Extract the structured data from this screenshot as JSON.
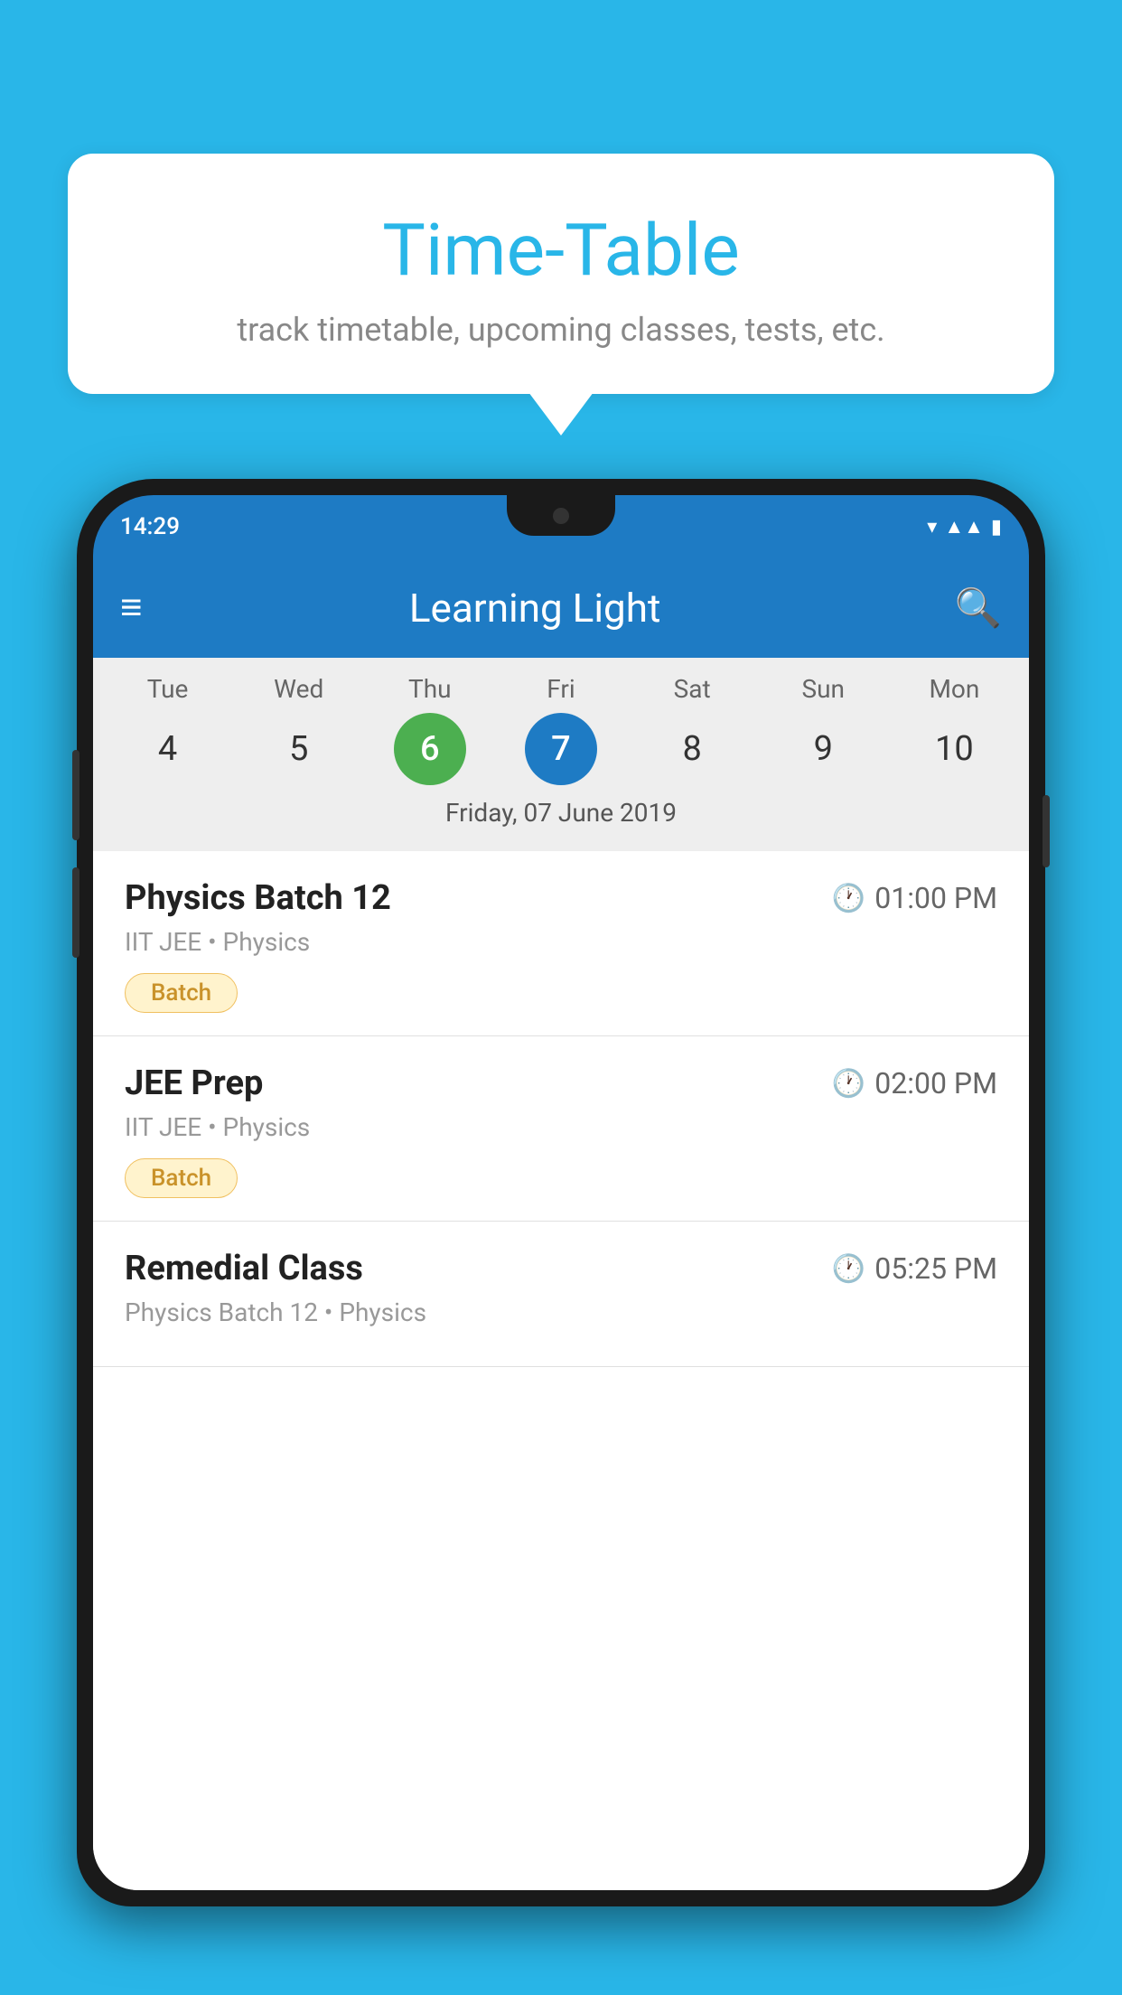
{
  "background_color": "#29b6e8",
  "tooltip": {
    "title": "Time-Table",
    "subtitle": "track timetable, upcoming classes, tests, etc."
  },
  "phone": {
    "status_time": "14:29",
    "app_name": "Learning Light",
    "calendar": {
      "days": [
        {
          "label": "Tue",
          "num": "4"
        },
        {
          "label": "Wed",
          "num": "5"
        },
        {
          "label": "Thu",
          "num": "6",
          "state": "today"
        },
        {
          "label": "Fri",
          "num": "7",
          "state": "selected"
        },
        {
          "label": "Sat",
          "num": "8"
        },
        {
          "label": "Sun",
          "num": "9"
        },
        {
          "label": "Mon",
          "num": "10"
        }
      ],
      "selected_date_label": "Friday, 07 June 2019"
    },
    "schedule": [
      {
        "title": "Physics Batch 12",
        "time": "01:00 PM",
        "subtitle": "IIT JEE • Physics",
        "badge": "Batch"
      },
      {
        "title": "JEE Prep",
        "time": "02:00 PM",
        "subtitle": "IIT JEE • Physics",
        "badge": "Batch"
      },
      {
        "title": "Remedial Class",
        "time": "05:25 PM",
        "subtitle": "Physics Batch 12 • Physics",
        "badge": null
      }
    ]
  }
}
